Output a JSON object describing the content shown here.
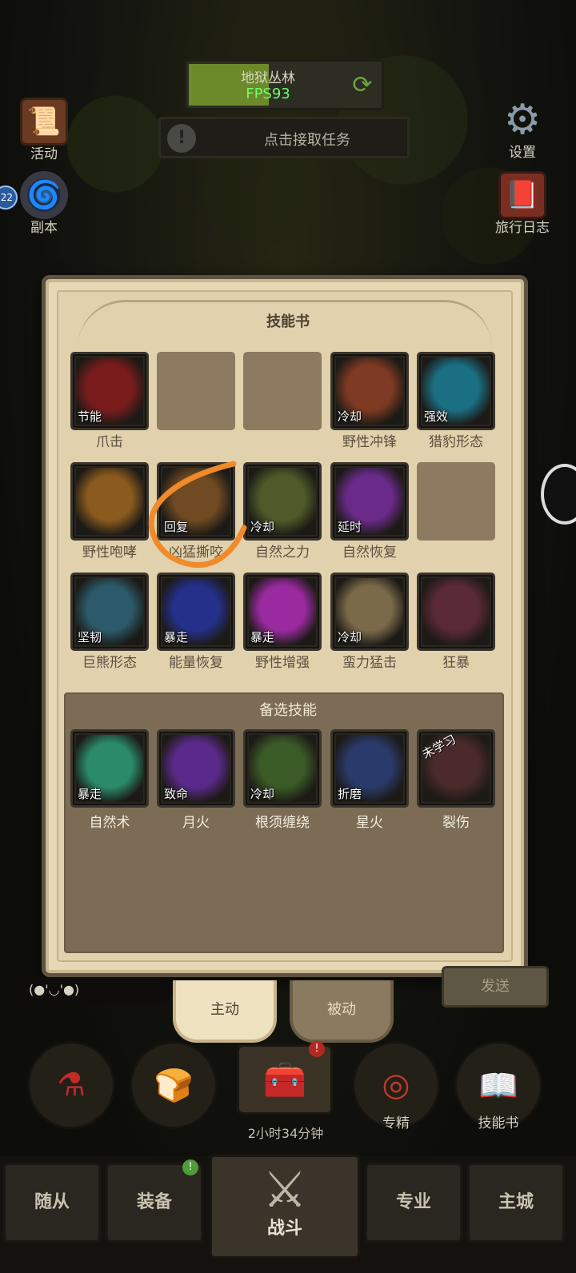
{
  "hud": {
    "zone_name": "地狱丛林",
    "fps": "FPS93",
    "quest_text": "点击接取任务",
    "quest_alert": "!",
    "level_badge": "22"
  },
  "left_buttons": [
    {
      "label": "活动",
      "icon": "scroll-board-icon"
    },
    {
      "label": "副本",
      "icon": "portal-icon"
    }
  ],
  "right_buttons": [
    {
      "label": "设置",
      "icon": "gear-icon"
    },
    {
      "label": "旅行日志",
      "icon": "book-icon"
    }
  ],
  "panel": {
    "title": "技能书",
    "equipped": [
      {
        "name": "爪击",
        "tag": "节能",
        "color": "#7a1c1c"
      },
      {
        "name": "",
        "tag": "",
        "empty": true
      },
      {
        "name": "",
        "tag": "",
        "empty": true
      },
      {
        "name": "野性冲锋",
        "tag": "冷却",
        "color": "#7e3a22"
      },
      {
        "name": "猎豹形态",
        "tag": "强效",
        "color": "#1b6f82"
      },
      {
        "name": "野性咆哮",
        "tag": "",
        "color": "#8a5a1e"
      },
      {
        "name": "凶猛撕咬",
        "tag": "回复",
        "color": "#6f4a22"
      },
      {
        "name": "自然之力",
        "tag": "冷却",
        "color": "#4e5a28"
      },
      {
        "name": "自然恢复",
        "tag": "延时",
        "color": "#6a2a8a"
      },
      {
        "name": "",
        "tag": "",
        "empty": true
      },
      {
        "name": "巨熊形态",
        "tag": "坚韧",
        "color": "#2c5a6a"
      },
      {
        "name": "能量恢复",
        "tag": "暴走",
        "color": "#24308a"
      },
      {
        "name": "野性增强",
        "tag": "暴走",
        "color": "#9a2aa0"
      },
      {
        "name": "蛮力猛击",
        "tag": "冷却",
        "color": "#7a6a4a"
      },
      {
        "name": "狂暴",
        "tag": "",
        "color": "#5a2a36"
      }
    ],
    "alt_title": "备选技能",
    "alternates": [
      {
        "name": "自然术",
        "tag": "暴走",
        "color": "#2a8a6a"
      },
      {
        "name": "月火",
        "tag": "致命",
        "color": "#5a2a8a"
      },
      {
        "name": "根须缠绕",
        "tag": "冷却",
        "color": "#3a5a26"
      },
      {
        "name": "星火",
        "tag": "折磨",
        "color": "#2a3a6a"
      },
      {
        "name": "裂伤",
        "tag": "未学习",
        "color": "#4a2a2a"
      }
    ]
  },
  "tabs": {
    "active": "主动",
    "inactive": "被动"
  },
  "chat": {
    "text": "(●'◡'●)",
    "send_label": "发送"
  },
  "actions": [
    {
      "label": "",
      "icon": "potion-icon"
    },
    {
      "label": "",
      "icon": "bread-icon"
    },
    {
      "label": "专精",
      "icon": "specialization-icon"
    },
    {
      "label": "技能书",
      "icon": "skillbook-icon"
    }
  ],
  "chest": {
    "timer": "2小时34分钟",
    "badge": "!"
  },
  "nav": {
    "items": [
      "随从",
      "装备",
      "专业",
      "主城"
    ],
    "center_label": "战斗",
    "badge": "!"
  },
  "annotation_color": "#f08a2a"
}
